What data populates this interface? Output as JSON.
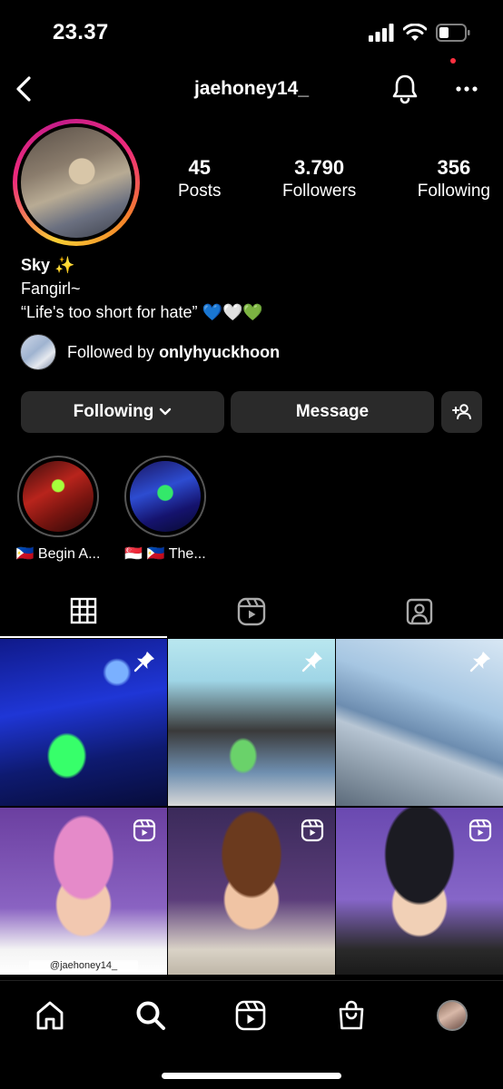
{
  "status_bar": {
    "time": "23.37"
  },
  "header": {
    "username": "jaehoney14_"
  },
  "profile": {
    "stats": [
      {
        "value": "45",
        "label": "Posts"
      },
      {
        "value": "3.790",
        "label": "Followers"
      },
      {
        "value": "356",
        "label": "Following"
      }
    ],
    "bio": {
      "name": "Sky ✨",
      "line1": "Fangirl~",
      "line2": "“Life's too short for hate” 💙🤍💚"
    },
    "followed_by": {
      "prefix": "Followed by",
      "user": "onlyhyuckhoon"
    }
  },
  "buttons": {
    "following": "Following",
    "message": "Message"
  },
  "highlights": [
    {
      "label": "🇵🇭 Begin A..."
    },
    {
      "label": "🇸🇬 🇵🇭 The..."
    }
  ],
  "tabs": [
    {
      "icon": "grid-icon",
      "active": true
    },
    {
      "icon": "reels-icon",
      "active": false
    },
    {
      "icon": "tagged-icon",
      "active": false
    }
  ],
  "grid": {
    "items": [
      {
        "badge": "pin-icon"
      },
      {
        "badge": "pin-icon"
      },
      {
        "badge": "pin-icon"
      },
      {
        "badge": "reels-icon",
        "watermark": "@jaehoney14_"
      },
      {
        "badge": "reels-icon"
      },
      {
        "badge": "reels-icon"
      }
    ]
  },
  "bottom_nav": [
    {
      "icon": "home-icon"
    },
    {
      "icon": "search-icon"
    },
    {
      "icon": "reels-icon"
    },
    {
      "icon": "shop-icon"
    },
    {
      "icon": "profile-avatar"
    }
  ],
  "colors": {
    "notification_dot": "#ff3040",
    "button_bg": "#2a2a2a"
  }
}
